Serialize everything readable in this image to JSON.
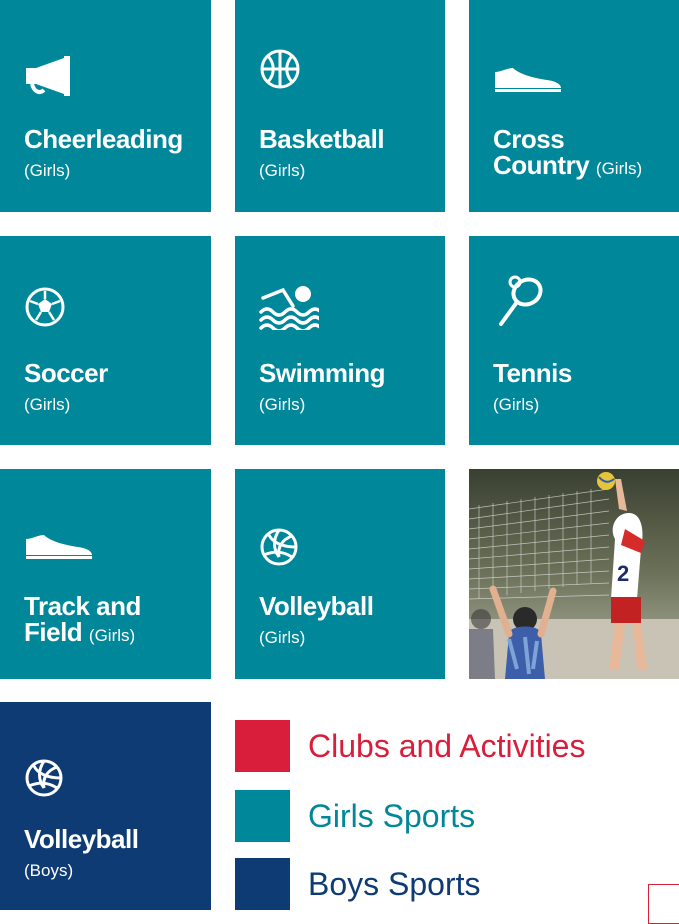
{
  "colors": {
    "teal": "#00879a",
    "navy": "#0e3b73",
    "red": "#d81e3a"
  },
  "tiles": [
    {
      "icon": "megaphone-icon",
      "name": "Cheerleading",
      "sub": "(Girls)"
    },
    {
      "icon": "basketball-icon",
      "name": "Basketball",
      "sub": "(Girls)"
    },
    {
      "icon": "shoe-icon",
      "name_line1": "Cross",
      "name_line2": "Country",
      "sub": "(Girls)"
    },
    {
      "icon": "soccer-ball-icon",
      "name": "Soccer",
      "sub": "(Girls)"
    },
    {
      "icon": "swimmer-icon",
      "name": "Swimming",
      "sub": "(Girls)"
    },
    {
      "icon": "tennis-racket-icon",
      "name": "Tennis",
      "sub": "(Girls)"
    },
    {
      "icon": "shoe-icon",
      "name_line1": "Track and",
      "name_line2": "Field",
      "sub": "(Girls)"
    },
    {
      "icon": "volleyball-icon",
      "name": "Volleyball",
      "sub": "(Girls)"
    },
    {
      "icon": "volleyball-icon",
      "name": "Volleyball",
      "sub": "(Boys)"
    }
  ],
  "photo": {
    "subject": "volleyball-players-photo",
    "jersey_number": "2"
  },
  "legend": [
    {
      "label": "Clubs and Activities",
      "color": "#d81e3a"
    },
    {
      "label": "Girls Sports",
      "color": "#00879a"
    },
    {
      "label": "Boys Sports",
      "color": "#0e3b73"
    }
  ]
}
